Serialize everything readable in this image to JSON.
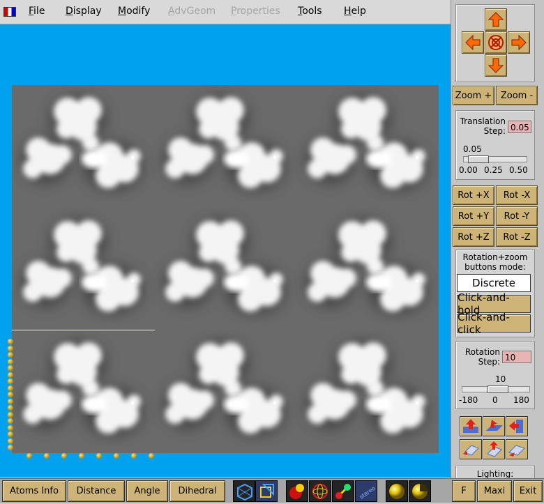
{
  "menu": {
    "items": [
      {
        "label": "File",
        "mnemonic": "F",
        "rest": "ile",
        "enabled": true
      },
      {
        "label": "Display",
        "mnemonic": "D",
        "rest": "isplay",
        "enabled": true
      },
      {
        "label": "Modify",
        "mnemonic": "M",
        "rest": "odify",
        "enabled": true
      },
      {
        "label": "AdvGeom",
        "mnemonic": "A",
        "rest": "dvGeom",
        "enabled": false
      },
      {
        "label": "Properties",
        "mnemonic": "P",
        "rest": "roperties",
        "enabled": false
      },
      {
        "label": "Tools",
        "mnemonic": "T",
        "rest": "ools",
        "enabled": true
      },
      {
        "label": "Help",
        "mnemonic": "H",
        "rest": "elp",
        "enabled": true
      }
    ]
  },
  "panel": {
    "zoom_in": "Zoom +",
    "zoom_out": "Zoom -",
    "translation": {
      "label_line1": "Translation",
      "label_line2": "Step:",
      "value": "0.05",
      "slider_value": "0.05",
      "slider_fraction": 0.1,
      "ticks": [
        "0.00",
        "0.25",
        "0.50"
      ]
    },
    "rotation_buttons": {
      "px": "Rot +X",
      "mx": "Rot -X",
      "py": "Rot +Y",
      "my": "Rot -Y",
      "pz": "Rot +Z",
      "mz": "Rot -Z"
    },
    "mode": {
      "label_line1": "Rotation+zoom",
      "label_line2": "buttons mode:",
      "options": [
        "Discrete",
        "Click-and-hold",
        "Click-and-click"
      ],
      "selected": "Discrete"
    },
    "rotation": {
      "label_line1": "Rotation",
      "label_line2": "Step:",
      "value": "10",
      "slider_value": "10",
      "slider_fraction": 0.528,
      "ticks": [
        "-180",
        "0",
        "180"
      ]
    },
    "lighting_label": "Lighting:"
  },
  "bottom": {
    "atoms_info": "Atoms Info",
    "distance": "Distance",
    "angle": "Angle",
    "dihedral": "Dihedral",
    "f": "F",
    "maxi": "Maxi",
    "exit": "Exit"
  },
  "colors": {
    "viewport_bg": "#00a2f0",
    "button": "#cdb476",
    "arrow_fill": "#ff6a00",
    "input_bg": "#e8b3b3"
  },
  "icons": {
    "nav": [
      "arrow-up-icon",
      "arrow-left-icon",
      "reset-view-icon",
      "arrow-right-icon",
      "arrow-down-icon"
    ],
    "view": [
      "view-front-icon",
      "view-top-icon",
      "view-side-icon",
      "view-back-icon",
      "view-bottom-icon",
      "view-iso-icon"
    ],
    "tools": [
      "unit-cell-blue-icon",
      "unit-cell-yellow-icon",
      "spheres-icon",
      "wireframe-sphere-icon",
      "ball-stick-icon",
      "stereo-icon",
      "yellow-sphere-icon",
      "half-sphere-icon"
    ]
  }
}
